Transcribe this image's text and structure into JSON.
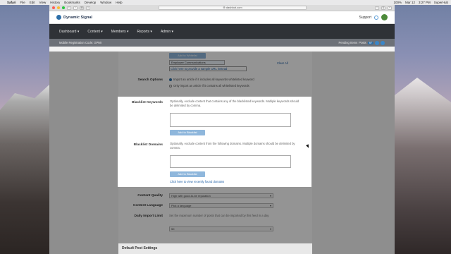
{
  "mac": {
    "menu": [
      "Safari",
      "File",
      "Edit",
      "View",
      "History",
      "Bookmarks",
      "Develop",
      "Window",
      "Help"
    ],
    "status_right": [
      "Mar 12",
      "3:27 PM",
      "SuperHub",
      "100%"
    ]
  },
  "browser": {
    "url": "⊕ dashbot.com"
  },
  "app": {
    "brand": "Dynamic Signal",
    "support_label": "Support",
    "nav": [
      "Dashboard ▾",
      "Content ▾",
      "Members ▾",
      "Reports ▾",
      "Admin ▾"
    ],
    "subbar_left": "Mobile Registration Code: GPMI",
    "subbar_right_label": "Pending Items",
    "subbar_pill": "Posts",
    "subbar_count": "97"
  },
  "form": {
    "add_whitelist_button": "Add to Whitelist",
    "whitelist_tag": "Employee Communications",
    "whitelist_link": "Click here to provide a sample URL instead",
    "clear_all": "Clear All",
    "search_options_label": "Search Options",
    "search_option_1": "Import an article if it includes all keywords whitelisted keyword",
    "search_option_2": "Only import an article if it contains all whitelisted keywords",
    "blacklist_keywords_label": "Blacklist Keywords",
    "blacklist_keywords_help": "Optionally, exclude content that contains any of the blacklisted keywords. Multiple keywords should be delimited by comma.",
    "add_blacklist_button_1": "Add to Blacklist",
    "blacklist_domains_label": "Blacklist Domains",
    "blacklist_domains_help": "Optionally, exclude content from the following domains. Multiple domains should be delimited by comma.",
    "add_blacklist_button_2": "Add to Blacklist",
    "view_blocked_link": "Click here to view recently found domains",
    "content_quality_label": "Content Quality",
    "content_quality_value": "High with good-to-be reputation",
    "content_language_label": "Content Language",
    "content_language_value": "Pick a language",
    "daily_import_label": "Daily Import Limit",
    "daily_import_help": "Set the maximum number of posts that can be imported by this feed in a day",
    "daily_import_value": "50",
    "default_post_settings": "Default Post Settings"
  }
}
